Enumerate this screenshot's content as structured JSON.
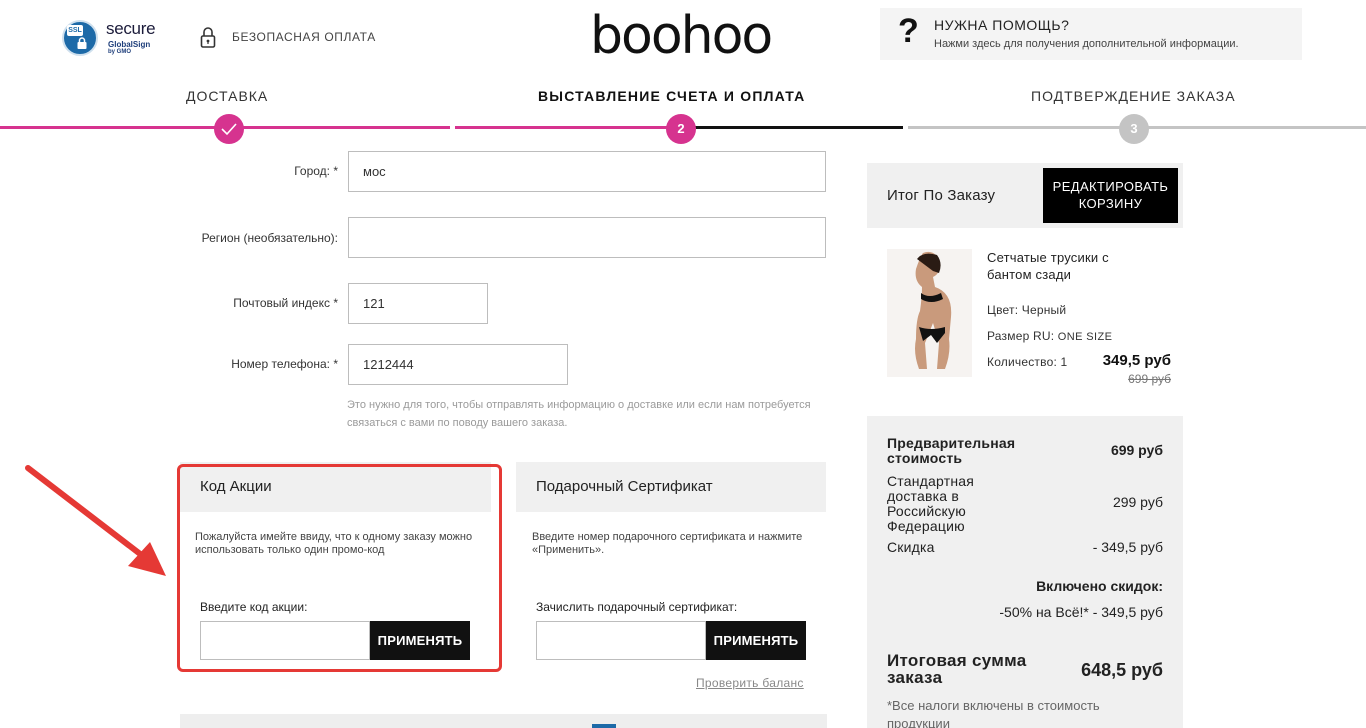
{
  "header": {
    "ssl_badge": {
      "ssl": "SSL",
      "word": "secure",
      "issuer": "GlobalSign",
      "sub": "by GMO"
    },
    "secure_payment": "БЕЗОПАСНАЯ ОПЛАТА",
    "logo": "boohoo",
    "help": {
      "title": "НУЖНА ПОМОЩЬ?",
      "subtitle": "Нажми здесь для получения дополнительной информации."
    }
  },
  "steps": [
    {
      "label": "ДОСТАВКА",
      "marker": "check-icon",
      "state": "done"
    },
    {
      "label": "ВЫСТАВЛЕНИЕ СЧЕТА И ОПЛАТА",
      "marker": "2",
      "state": "active"
    },
    {
      "label": "ПОДТВЕРЖДЕНИЕ ЗАКАЗА",
      "marker": "3",
      "state": "pending"
    }
  ],
  "colors": {
    "accent": "#d6338f",
    "inactive": "#c4c4c4",
    "dark": "#111111",
    "alert": "#e53935"
  },
  "form": {
    "city": {
      "label": "Город: *",
      "value": "мос"
    },
    "region": {
      "label": "Регион (необязательно):",
      "value": ""
    },
    "zip": {
      "label": "Почтовый индекс *",
      "value": "121"
    },
    "phone": {
      "label": "Номер телефона: *",
      "value": "1212444"
    },
    "hint": "Это нужно для того, чтобы отправлять информацию о доставке или если нам потребуется связаться с вами по поводу вашего заказа."
  },
  "promo": {
    "title": "Код Акции",
    "text": "Пожалуйста имейте ввиду, что к одному заказу можно использовать только один промо-код",
    "label": "Введите код акции:",
    "value": "",
    "button": "ПРИМЕНЯТЬ"
  },
  "gift": {
    "title": "Подарочный Сертификат",
    "text": "Введите номер подарочного сертификата и нажмите «Применить».",
    "label": "Зачислить подарочный сертификат:",
    "value": "",
    "button": "ПРИМЕНЯТЬ",
    "balance_link": "Проверить баланс"
  },
  "summary": {
    "title": "Итог По Заказу",
    "edit_button": "РЕДАКТИРОВАТЬ КОРЗИНУ",
    "product": {
      "name": "Сетчатые трусики с бантом сзади",
      "color": "Цвет: Черный",
      "size_label": "Размер RU:",
      "size_value": "ONE SIZE",
      "qty": "Количество: 1",
      "price": "349,5 руб",
      "old_price": "699 руб"
    },
    "totals": {
      "subtotal_label": "Предварительная стоимость",
      "subtotal_value": "699 руб",
      "shipping_label": "Стандартная доставка в Российскую Федерацию",
      "shipping_value": "299 руб",
      "discount_label": "Скидка",
      "discount_value": "- 349,5 руб",
      "included_label": "Включено скидок:",
      "included_promo": "-50% на Всё!* - 349,5 руб",
      "grand_label": "Итоговая сумма заказа",
      "grand_value": "648,5 руб",
      "note": "*Все налоги включены в стоимость продукции"
    }
  }
}
